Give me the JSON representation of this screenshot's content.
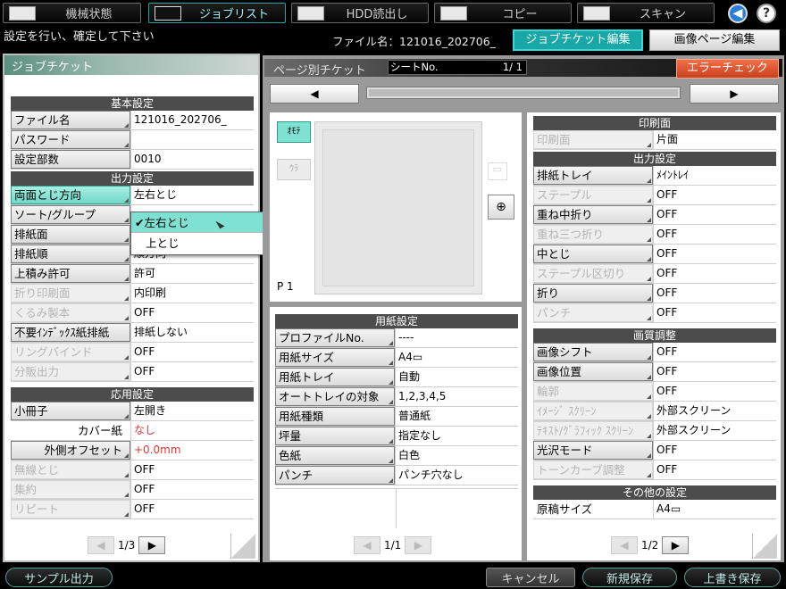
{
  "top_tabs": [
    {
      "label": "機械状態",
      "icon": "machine-status-icon"
    },
    {
      "label": "ジョブリスト",
      "icon": "job-list-icon"
    },
    {
      "label": "HDD読出し",
      "icon": "hdd-icon"
    },
    {
      "label": "コピー",
      "icon": "copy-icon"
    },
    {
      "label": "スキャン",
      "icon": "scan-icon"
    }
  ],
  "instruction": "設定を行い、確定して下さい",
  "file_name": "ファイル名：121016_202706_",
  "edit_tabs": {
    "ticket": "ジョブチケット編集",
    "image_page": "画像ページ編集"
  },
  "left": {
    "title": "ジョブチケット",
    "basic": {
      "header": "基本設定",
      "rows": [
        {
          "k": "ファイル名",
          "v": "121016_202706_"
        },
        {
          "k": "パスワード",
          "v": ""
        },
        {
          "k": "設定部数",
          "v": "0010"
        }
      ]
    },
    "output": {
      "header": "出力設定",
      "rows": [
        {
          "k": "両面とじ方向",
          "v": "左右とじ"
        },
        {
          "k": "ソート/グループ",
          "v": ""
        },
        {
          "k": "排紙面",
          "v": ""
        },
        {
          "k": "排紙順",
          "v": "順方向"
        },
        {
          "k": "上積み許可",
          "v": "許可"
        },
        {
          "k": "折り印刷面",
          "v": "内印刷"
        },
        {
          "k": "くるみ製本",
          "v": "OFF"
        },
        {
          "k": "不要ｲﾝﾃﾞｯｸｽ紙排紙",
          "v": "排紙しない"
        },
        {
          "k": "リングバインド",
          "v": "OFF"
        },
        {
          "k": "分販出力",
          "v": "OFF"
        }
      ]
    },
    "applied": {
      "header": "応用設定",
      "rows": [
        {
          "k": "小冊子",
          "v": "左開き"
        },
        {
          "k": "カバー紙",
          "v": "なし"
        },
        {
          "k": "外側オフセット",
          "v": "+0.0mm"
        },
        {
          "k": "無線とじ",
          "v": "OFF"
        },
        {
          "k": "集約",
          "v": "OFF"
        },
        {
          "k": "リピート",
          "v": "OFF"
        }
      ]
    },
    "page": "1/3"
  },
  "dropdown": {
    "options": [
      "左右とじ",
      "上とじ"
    ],
    "check": "✔"
  },
  "page_view": {
    "title": "ページ別チケット",
    "sheet_label": "シートNo.",
    "sheet_value": "1/   1",
    "error_check": "エラーチェック",
    "front": "ｵﾓﾃ",
    "back": "ｳﾗ",
    "page_marker": "P  1"
  },
  "paper": {
    "header": "用紙設定",
    "rows": [
      {
        "k": "プロファイルNo.",
        "v": "----"
      },
      {
        "k": "用紙サイズ",
        "v": "A4▭"
      },
      {
        "k": "用紙トレイ",
        "v": "自動"
      },
      {
        "k": "オートトレイの対象",
        "v": "1,2,3,4,5"
      },
      {
        "k": "用紙種類",
        "v": "普通紙"
      },
      {
        "k": "坪量",
        "v": "指定なし"
      },
      {
        "k": "色紙",
        "v": "白色"
      },
      {
        "k": "パンチ",
        "v": "パンチ穴なし"
      }
    ],
    "page": "1/1"
  },
  "right": {
    "print_side": {
      "header": "印刷面",
      "rows": [
        {
          "k": "印刷面",
          "v": "片面"
        }
      ]
    },
    "output": {
      "header": "出力設定",
      "rows": [
        {
          "k": "排紙トレイ",
          "v": "ﾒｲﾝﾄﾚｲ"
        },
        {
          "k": "ステープル",
          "v": "OFF"
        },
        {
          "k": "重ね中折り",
          "v": "OFF"
        },
        {
          "k": "重ね三つ折り",
          "v": "OFF"
        },
        {
          "k": "中とじ",
          "v": "OFF"
        },
        {
          "k": "ステープル区切り",
          "v": "OFF"
        },
        {
          "k": "折り",
          "v": "OFF"
        },
        {
          "k": "パンチ",
          "v": "OFF"
        }
      ]
    },
    "quality": {
      "header": "画質調整",
      "rows": [
        {
          "k": "画像シフト",
          "v": "OFF"
        },
        {
          "k": "画像位置",
          "v": "OFF"
        },
        {
          "k": "輪郭",
          "v": "OFF"
        },
        {
          "k": "ｲﾒｰｼﾞ ｽｸﾘｰﾝ",
          "v": "外部スクリーン"
        },
        {
          "k": "ﾃｷｽﾄ/ｸﾞﾗﾌｨｯｸ ｽｸﾘｰﾝ",
          "v": "外部スクリーン"
        },
        {
          "k": "光沢モード",
          "v": "OFF"
        },
        {
          "k": "トーンカーブ調整",
          "v": "OFF"
        }
      ]
    },
    "other": {
      "header": "その他の設定",
      "rows": [
        {
          "k": "原稿サイズ",
          "v": "A4▭"
        }
      ]
    },
    "page": "1/2"
  },
  "bottom": {
    "sample": "サンプル出力",
    "cancel": "キャンセル",
    "new_save": "新規保存",
    "overwrite": "上書き保存"
  },
  "colors": {
    "teal": "#1ea6a6",
    "error": "#e0502a",
    "red_value": "#e53434"
  }
}
